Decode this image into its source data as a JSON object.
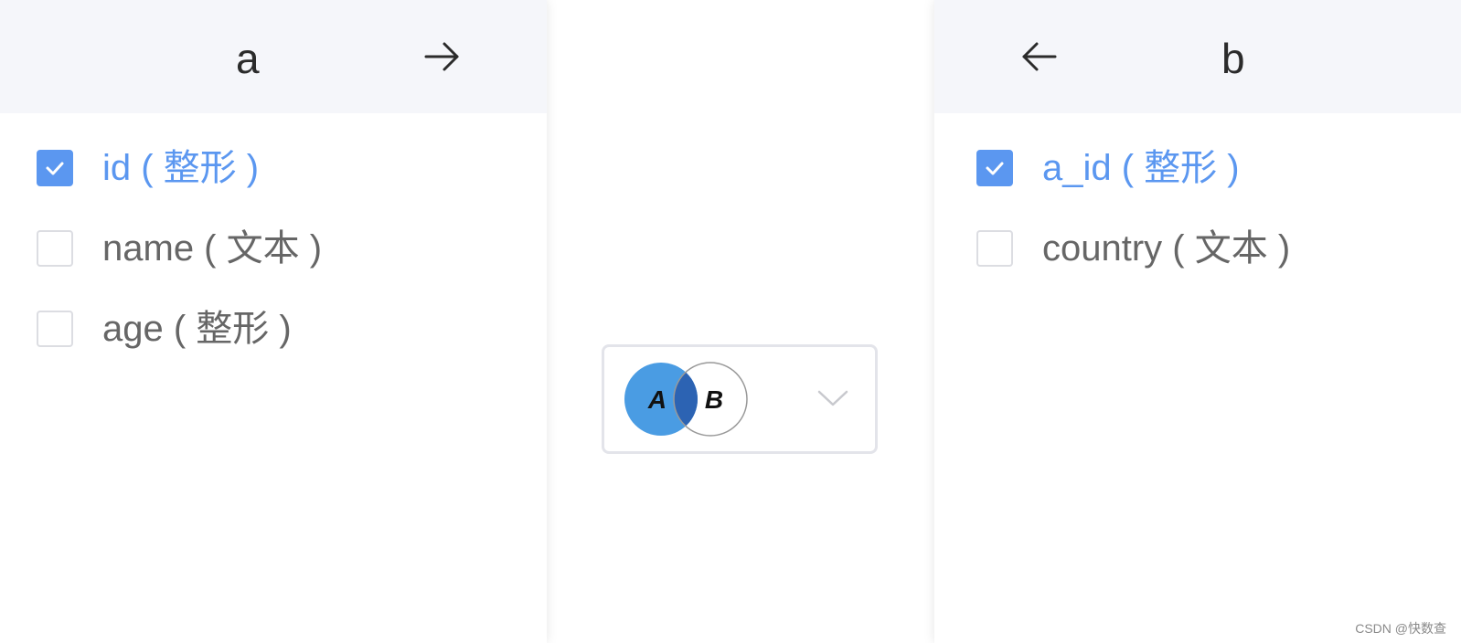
{
  "left_table": {
    "title": "a",
    "arrow_icon": "arrow-right-icon",
    "fields": [
      {
        "label": "id ( 整形 )",
        "checked": true
      },
      {
        "label": "name ( 文本 )",
        "checked": false
      },
      {
        "label": "age ( 整形 )",
        "checked": false
      }
    ]
  },
  "right_table": {
    "title": "b",
    "arrow_icon": "arrow-left-icon",
    "fields": [
      {
        "label": "a_id ( 整形 )",
        "checked": true
      },
      {
        "label": "country ( 文本 )",
        "checked": false
      }
    ]
  },
  "join_selector": {
    "selected": "left-join",
    "circle_a_label": "A",
    "circle_b_label": "B",
    "icon": "venn-diagram-icon",
    "dropdown_icon": "chevron-down-icon"
  },
  "watermark": "CSDN @快数查",
  "colors": {
    "accent": "#5b97f0",
    "venn_fill": "#4a9ce3",
    "venn_overlap": "#2c63b3",
    "header_bg": "#f5f6fa",
    "text_muted": "#666666"
  }
}
